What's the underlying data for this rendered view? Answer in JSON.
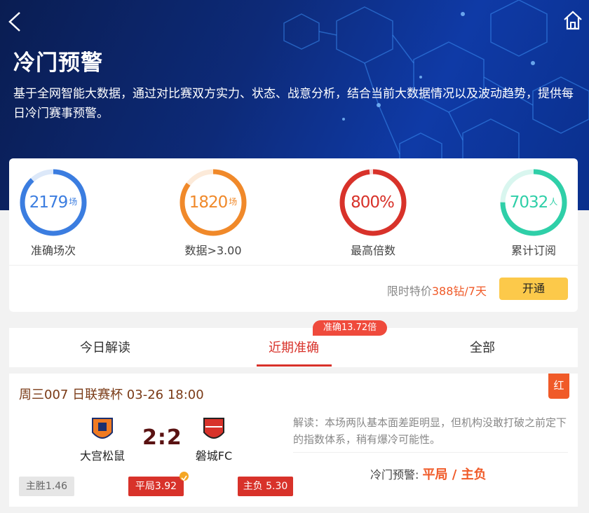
{
  "header": {
    "title": "冷门预警",
    "description": "基于全网智能大数据，通过对比赛双方实力、状态、战意分析，结合当前大数据情况以及波动趋势，提供每日冷门赛事预警。"
  },
  "stats": [
    {
      "value": "2179",
      "unit": "场",
      "label": "准确场次",
      "color": "#3b7de0",
      "fill": 0.88
    },
    {
      "value": "1820",
      "unit": "场",
      "label": "数据>3.00",
      "color": "#f0892a",
      "fill": 0.85
    },
    {
      "value": "800%",
      "unit": "",
      "label": "最高倍数",
      "color": "#d8322a",
      "fill": 0.98
    },
    {
      "value": "7032",
      "unit": "人",
      "label": "累计订阅",
      "color": "#2fcfa8",
      "fill": 0.75
    }
  ],
  "offer": {
    "prefix": "限时特价",
    "price": "388钻/7天",
    "button": "开通"
  },
  "tabs": {
    "items": [
      "今日解读",
      "近期准确",
      "全部"
    ],
    "active": 1,
    "badge": "准确13.72倍"
  },
  "match": {
    "header": "周三007 日联赛杯 03-26 18:00",
    "tag": "红",
    "home": {
      "name": "大宫松鼠"
    },
    "away": {
      "name": "磐城FC"
    },
    "score": "2:2",
    "odds": [
      {
        "label": "主胜1.46",
        "hit": false
      },
      {
        "label": "平局3.92",
        "hit": true
      },
      {
        "label": "主负 5.30",
        "hit": true
      }
    ],
    "analysis": "解读：本场两队基本面差距明显，但机构没敢打破之前定下的指数体系，稍有爆冷可能性。",
    "warning_label": "冷门预警:",
    "warning_pick": "平局 / 主负"
  }
}
